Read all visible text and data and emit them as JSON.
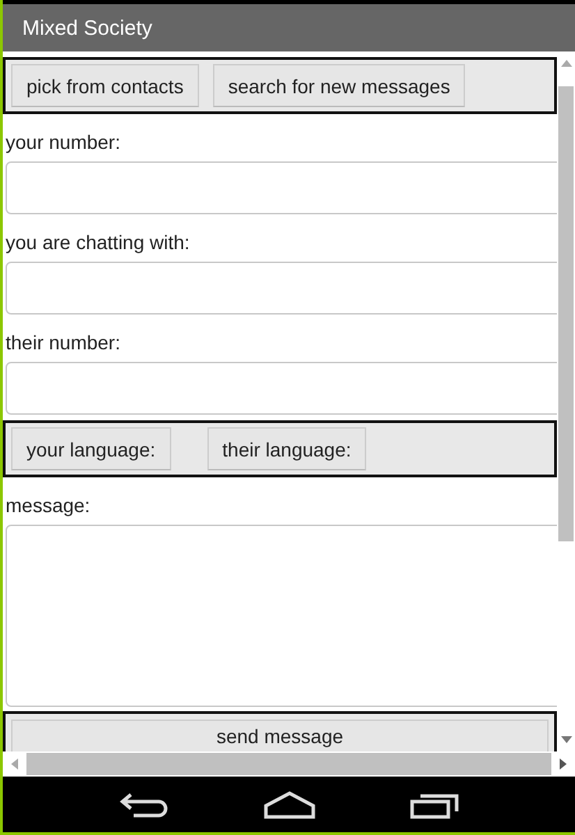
{
  "window": {
    "title": "Mixed Society"
  },
  "top_buttons": [
    "pick from contacts",
    "search for new messages"
  ],
  "fields": [
    {
      "label": "your number:",
      "kind": "input"
    },
    {
      "label": "you are chatting with:",
      "kind": "input"
    },
    {
      "label": "their number:",
      "kind": "input"
    }
  ],
  "language_buttons": [
    "your language:",
    "their language:"
  ],
  "message": {
    "label": "message:",
    "kind": "textarea"
  },
  "send_button": "send message"
}
